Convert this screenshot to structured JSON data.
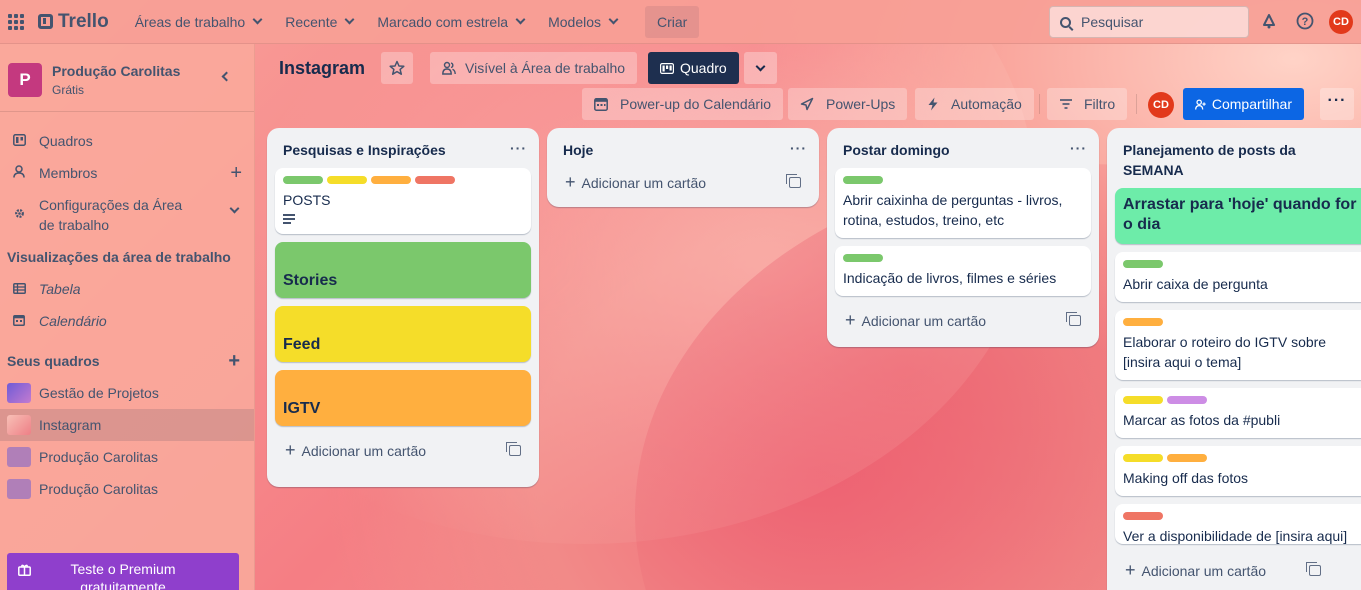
{
  "topbar": {
    "logo": "Trello",
    "nav": [
      {
        "label": "Áreas de trabalho"
      },
      {
        "label": "Recente"
      },
      {
        "label": "Marcado com estrela"
      },
      {
        "label": "Modelos"
      }
    ],
    "create": "Criar",
    "search_placeholder": "Pesquisar",
    "avatar": "CD"
  },
  "sidebar": {
    "workspace_initial": "P",
    "workspace_name": "Produção Carolitas",
    "workspace_plan": "Grátis",
    "items": [
      {
        "label": "Quadros"
      },
      {
        "label": "Membros"
      },
      {
        "label": "Configurações da Área de trabalho"
      }
    ],
    "views_heading": "Visualizações da área de trabalho",
    "views": [
      {
        "label": "Tabela"
      },
      {
        "label": "Calendário"
      }
    ],
    "boards_heading": "Seus quadros",
    "boards": [
      {
        "label": "Gestão de Projetos",
        "color": "#6f5bd6"
      },
      {
        "label": "Instagram",
        "color": "#f4a59f"
      },
      {
        "label": "Produção Carolitas",
        "color": "#b07fb8"
      },
      {
        "label": "Produção Carolitas",
        "color": "#b07fb8"
      }
    ],
    "premium": "Teste o Premium gratuitamente"
  },
  "board": {
    "title": "Instagram",
    "visibility": "Visível à Área de trabalho",
    "view": "Quadro",
    "calendar_powerup": "Power-up do Calendário",
    "powerups": "Power-Ups",
    "automation": "Automação",
    "filter": "Filtro",
    "member": "CD",
    "share": "Compartilhar"
  },
  "add_card_label": "Adicionar um cartão",
  "colors": {
    "green": "#4bce97",
    "label_green": "#7bc86c",
    "yellow": "#f5dd29",
    "orange": "#ffaf3f",
    "red": "#ef7564",
    "purple": "#cd8de5",
    "cover_green": "#7bc86c",
    "cover_yellow": "#f5dd29",
    "cover_orange": "#ffaf3f",
    "cover_mint": "#6deca9"
  },
  "lists": [
    {
      "title": "Pesquisas e Inspirações",
      "cards": [
        {
          "title": "POSTS"
        },
        {
          "title": "Stories"
        },
        {
          "title": "Feed"
        },
        {
          "title": "IGTV"
        }
      ]
    },
    {
      "title": "Hoje",
      "cards": []
    },
    {
      "title": "Postar domingo",
      "cards": [
        {
          "title": "Abrir caixinha de perguntas - livros, rotina, estudos, treino, etc"
        },
        {
          "title": "Indicação de livros, filmes e séries"
        }
      ]
    },
    {
      "title": "Planejamento de posts da SEMANA",
      "cards": [
        {
          "title": "Arrastar para 'hoje' quando for o dia"
        },
        {
          "title": "Abrir caixa de pergunta"
        },
        {
          "title": "Elaborar o roteiro do IGTV sobre [insira aqui o tema]"
        },
        {
          "title": "Marcar as fotos da #publi"
        },
        {
          "title": "Making off das fotos"
        },
        {
          "title": "Ver a disponibilidade de [insira aqui]"
        }
      ]
    }
  ]
}
